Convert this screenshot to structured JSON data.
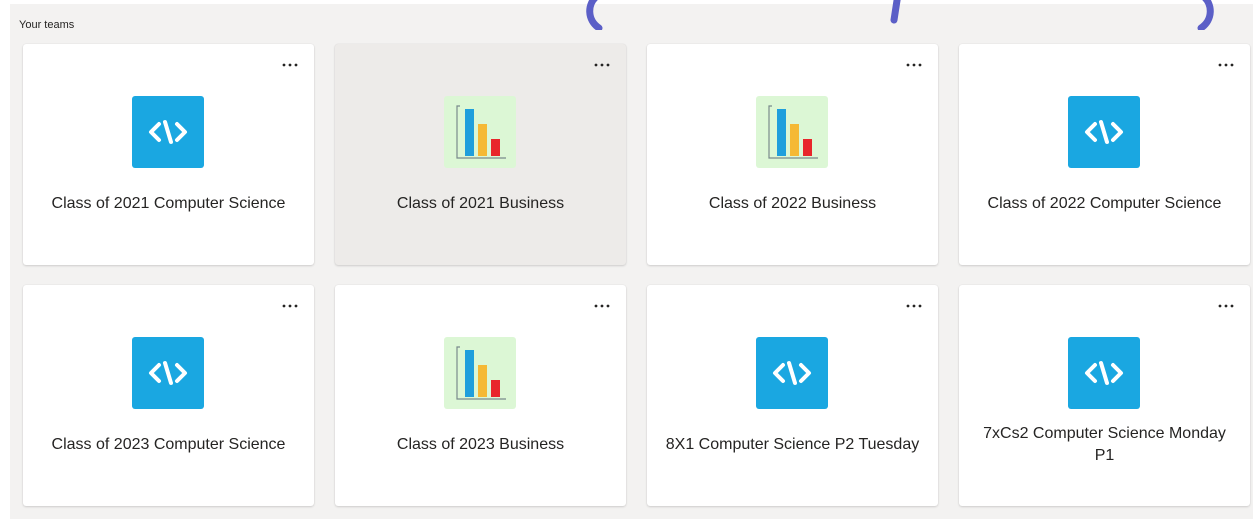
{
  "section": {
    "title": "Your teams"
  },
  "colors": {
    "code_tile": "#1aa7e1",
    "chart_tile": "#dcf7d5",
    "card_hover": "#edebe9"
  },
  "teams": [
    {
      "name": "Class of 2021 Computer Science",
      "icon": "code-icon",
      "more_label": "More options"
    },
    {
      "name": "Class of 2021 Business",
      "icon": "bar-chart-icon",
      "more_label": "More options",
      "hovered": true
    },
    {
      "name": "Class of 2022 Business",
      "icon": "bar-chart-icon",
      "more_label": "More options"
    },
    {
      "name": "Class of 2022 Computer Science",
      "icon": "code-icon",
      "more_label": "More options"
    },
    {
      "name": "Class of 2023 Computer Science",
      "icon": "code-icon",
      "more_label": "More options"
    },
    {
      "name": "Class of 2023 Business",
      "icon": "bar-chart-icon",
      "more_label": "More options"
    },
    {
      "name": "8X1 Computer Science P2 Tuesday",
      "icon": "code-icon",
      "more_label": "More options"
    },
    {
      "name": "7xCs2 Computer Science Monday P1",
      "icon": "code-icon",
      "more_label": "More options"
    }
  ]
}
